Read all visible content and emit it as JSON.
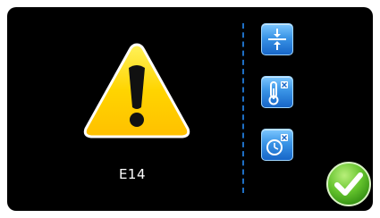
{
  "status": {
    "error_code": "E14"
  },
  "icons": {
    "warning": "warning-triangle-icon",
    "level_adjust": "vertical-level-icon",
    "temperature": "thermometer-icon",
    "timer": "clock-icon",
    "confirm": "checkmark-icon"
  },
  "colors": {
    "background": "#000000",
    "warning_yellow": "#ffd800",
    "button_blue": "#2f8ee6",
    "divider_blue": "#1e6fc4",
    "confirm_green": "#5fbf2a"
  }
}
